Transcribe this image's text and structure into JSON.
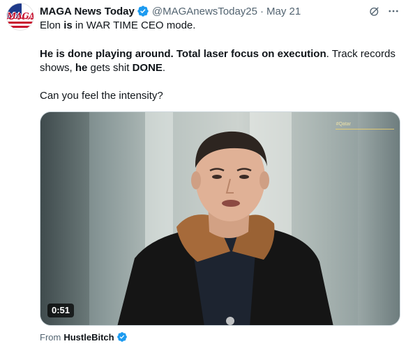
{
  "author": {
    "name": "MAGA News Today",
    "handle": "@MAGAnewsToday25",
    "separator": "·",
    "date": "May 21",
    "avatar_text": "MAGA",
    "verified_color": "#1d9bf0"
  },
  "tweet": {
    "line1": {
      "a": "Elon ",
      "b": "is",
      "c": " in WAR TIME CEO mode."
    },
    "line2": {
      "b1": "He is done playing around. Total laser focus on execution",
      "t1": ". Track records shows, ",
      "b2": "he",
      "t2": " gets shit ",
      "b3": "DONE",
      "t3": "."
    },
    "line3": "Can you feel the intensity?"
  },
  "media": {
    "type": "video",
    "duration": "0:51",
    "watermark": "#Qatar"
  },
  "source": {
    "prefix": "From",
    "name": "HustleBitch"
  },
  "icons": [
    "grok-icon",
    "more-icon",
    "verified-badge-icon"
  ]
}
